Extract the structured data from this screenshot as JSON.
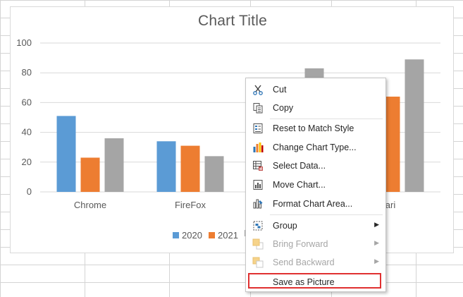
{
  "chart": {
    "title": "Chart Title",
    "legend": [
      {
        "label": "2020",
        "color": "#5b9bd5"
      },
      {
        "label": "2021",
        "color": "#ed7d31"
      },
      {
        "label": "",
        "color": "#a5a5a5"
      }
    ]
  },
  "chart_data": {
    "type": "bar",
    "title": "Chart Title",
    "categories": [
      "Chrome",
      "FireFox",
      "",
      "ari"
    ],
    "series": [
      {
        "name": "2020",
        "color": "#5b9bd5",
        "values": [
          51,
          34,
          null,
          null
        ]
      },
      {
        "name": "2021",
        "color": "#ed7d31",
        "values": [
          23,
          31,
          null,
          64
        ]
      },
      {
        "name": "",
        "color": "#a5a5a5",
        "values": [
          36,
          24,
          83,
          89
        ]
      }
    ],
    "ylim": [
      0,
      100
    ],
    "yticks": [
      0,
      20,
      40,
      60,
      80,
      100
    ],
    "grid": true,
    "legend_position": "bottom"
  },
  "context_menu": {
    "items": [
      {
        "label": "Cut",
        "icon": "scissors-icon",
        "enabled": true,
        "submenu": false
      },
      {
        "label": "Copy",
        "icon": "copy-icon",
        "enabled": true,
        "submenu": false
      },
      {
        "label": "Reset to Match Style",
        "icon": "reset-style-icon",
        "enabled": true,
        "submenu": false
      },
      {
        "label": "Change Chart Type...",
        "icon": "chart-type-icon",
        "enabled": true,
        "submenu": false
      },
      {
        "label": "Select Data...",
        "icon": "select-data-icon",
        "enabled": true,
        "submenu": false
      },
      {
        "label": "Move Chart...",
        "icon": "move-chart-icon",
        "enabled": true,
        "submenu": false
      },
      {
        "label": "Format Chart Area...",
        "icon": "format-area-icon",
        "enabled": true,
        "submenu": false
      },
      {
        "label": "Group",
        "icon": "group-icon",
        "enabled": true,
        "submenu": true
      },
      {
        "label": "Bring Forward",
        "icon": "bring-forward-icon",
        "enabled": false,
        "submenu": true
      },
      {
        "label": "Send Backward",
        "icon": "send-backward-icon",
        "enabled": false,
        "submenu": true
      },
      {
        "label": "Save as Picture",
        "icon": "",
        "enabled": true,
        "submenu": false,
        "highlighted": true
      }
    ],
    "submenu_arrow": "▶",
    "highlight_color": "#e03030"
  }
}
